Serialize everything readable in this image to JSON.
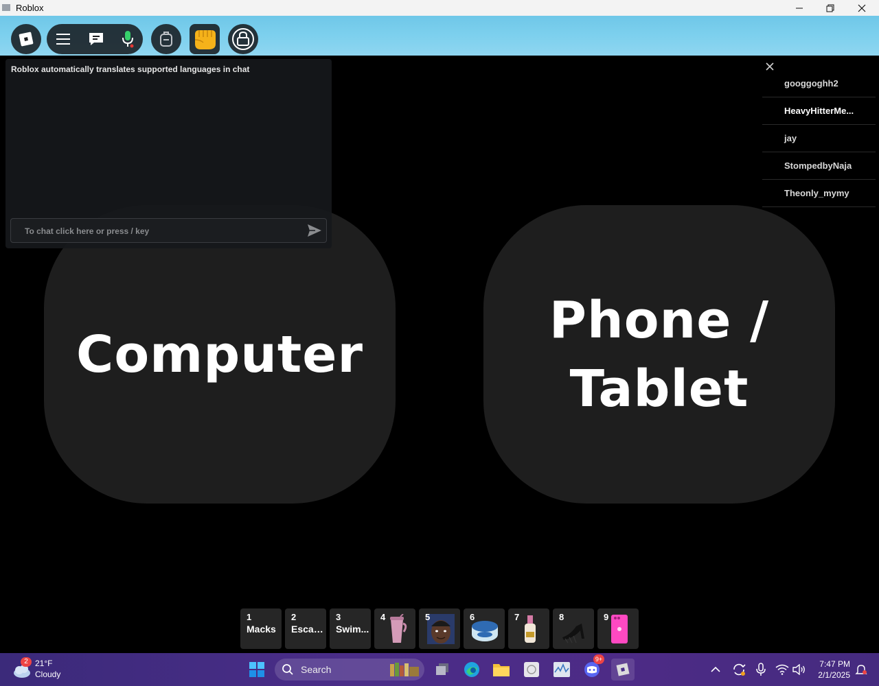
{
  "window": {
    "title": "Roblox"
  },
  "chat": {
    "notice": "Roblox automatically translates supported languages in chat",
    "placeholder": "To chat click here or press / key"
  },
  "choices": {
    "computer_label": "Computer",
    "phone_label": "Phone /\nTablet"
  },
  "players": [
    {
      "name": "googgoghh2"
    },
    {
      "name": "HeavyHitterMe..."
    },
    {
      "name": "jay"
    },
    {
      "name": "StompedbyNaja"
    },
    {
      "name": "Theonly_mymy"
    }
  ],
  "hotbar": [
    {
      "num": "1",
      "name": "Macks"
    },
    {
      "num": "2",
      "name": "Escap..."
    },
    {
      "num": "3",
      "name": "Swim..."
    },
    {
      "num": "4",
      "name": "",
      "icon": "tumbler-icon"
    },
    {
      "num": "5",
      "name": "",
      "icon": "face-photo-icon"
    },
    {
      "num": "6",
      "name": "",
      "icon": "vaseline-jar-icon"
    },
    {
      "num": "7",
      "name": "",
      "icon": "bottle-icon"
    },
    {
      "num": "8",
      "name": "",
      "icon": "heels-icon"
    },
    {
      "num": "9",
      "name": "",
      "icon": "pink-phone-icon"
    }
  ],
  "taskbar": {
    "weather_badge": "2",
    "temperature": "21°F",
    "condition": "Cloudy",
    "search_label": "Search",
    "discord_badge": "9+",
    "time": "7:47 PM",
    "date": "2/1/2025"
  },
  "colors": {
    "sky": "#7dd0ee",
    "choice_bg": "#1e1e1e",
    "taskbar": "#4a2d88"
  }
}
